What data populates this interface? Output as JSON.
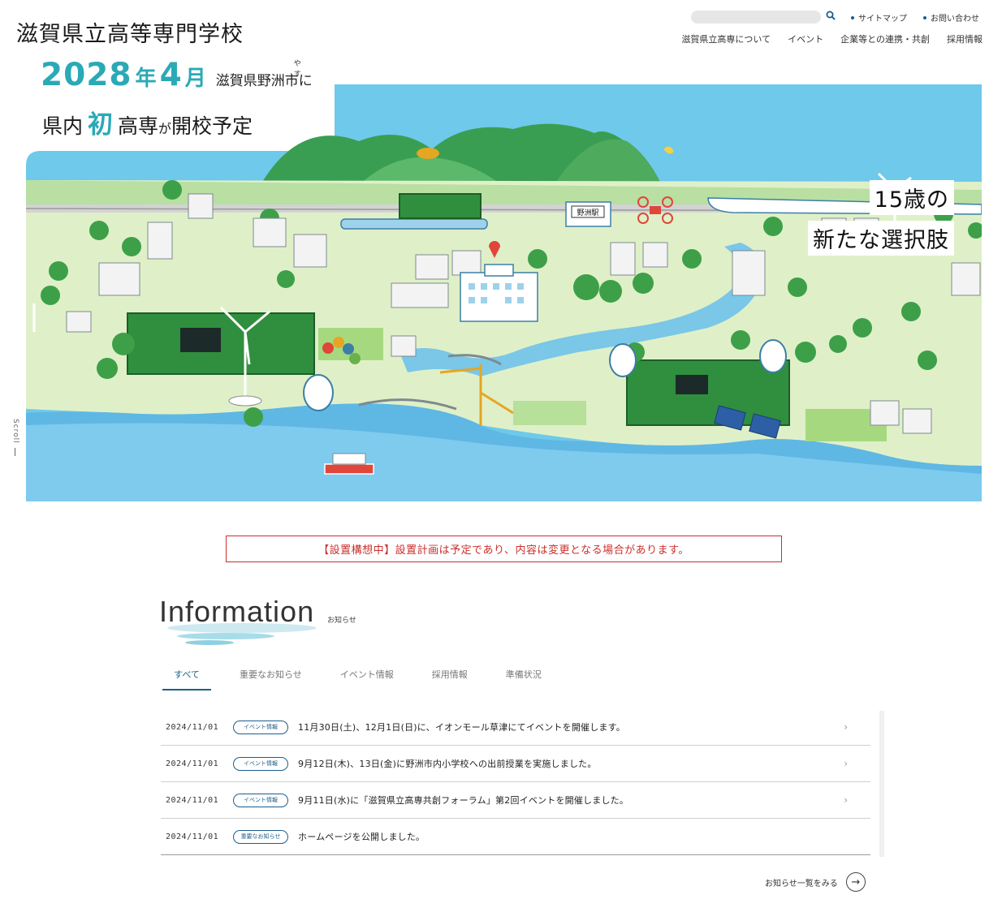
{
  "header": {
    "title": "滋賀県立高等専門学校",
    "search_placeholder": "",
    "utility_links": [
      "サイトマップ",
      "お問い合わせ"
    ],
    "nav": [
      "滋賀県立高専について",
      "イベント",
      "企業等との連携・共創",
      "採用情報"
    ]
  },
  "hero": {
    "year": "2028",
    "year_suffix": "年",
    "month": "4",
    "month_suffix": "月",
    "location": "滋賀県野洲市に",
    "ruby": "やす",
    "line2_prefix": "県内",
    "line2_highlight": "初",
    "line2_mid": "高専",
    "line2_small": "が",
    "line2_suffix": "開校予定",
    "tag1": "15歳の",
    "tag2": "新たな選択肢",
    "station_label": "野洲駅",
    "scroll_label": "Scroll"
  },
  "notice": "【設置構想中】設置計画は予定であり、内容は変更となる場合があります。",
  "information": {
    "title": "Information",
    "subtitle": "お知らせ",
    "tabs": [
      "すべて",
      "重要なお知らせ",
      "イベント情報",
      "採用情報",
      "準備状況"
    ],
    "items": [
      {
        "date": "2024/11/01",
        "badge": "イベント情報",
        "text": "11月30日(土)、12月1日(日)に、イオンモール草津にてイベントを開催します。"
      },
      {
        "date": "2024/11/01",
        "badge": "イベント情報",
        "text": "9月12日(木)、13日(金)に野洲市内小学校への出前授業を実施しました。"
      },
      {
        "date": "2024/11/01",
        "badge": "イベント情報",
        "text": "9月11日(水)に「滋賀県立高専共創フォーラム」第2回イベントを開催しました。"
      },
      {
        "date": "2024/11/01",
        "badge": "重要なお知らせ",
        "text": "ホームページを公開しました。"
      }
    ],
    "more_label": "お知らせ一覧をみる"
  },
  "colors": {
    "accent": "#2aa9b6",
    "brand": "#1b5e8c",
    "notice": "#c9302c"
  }
}
